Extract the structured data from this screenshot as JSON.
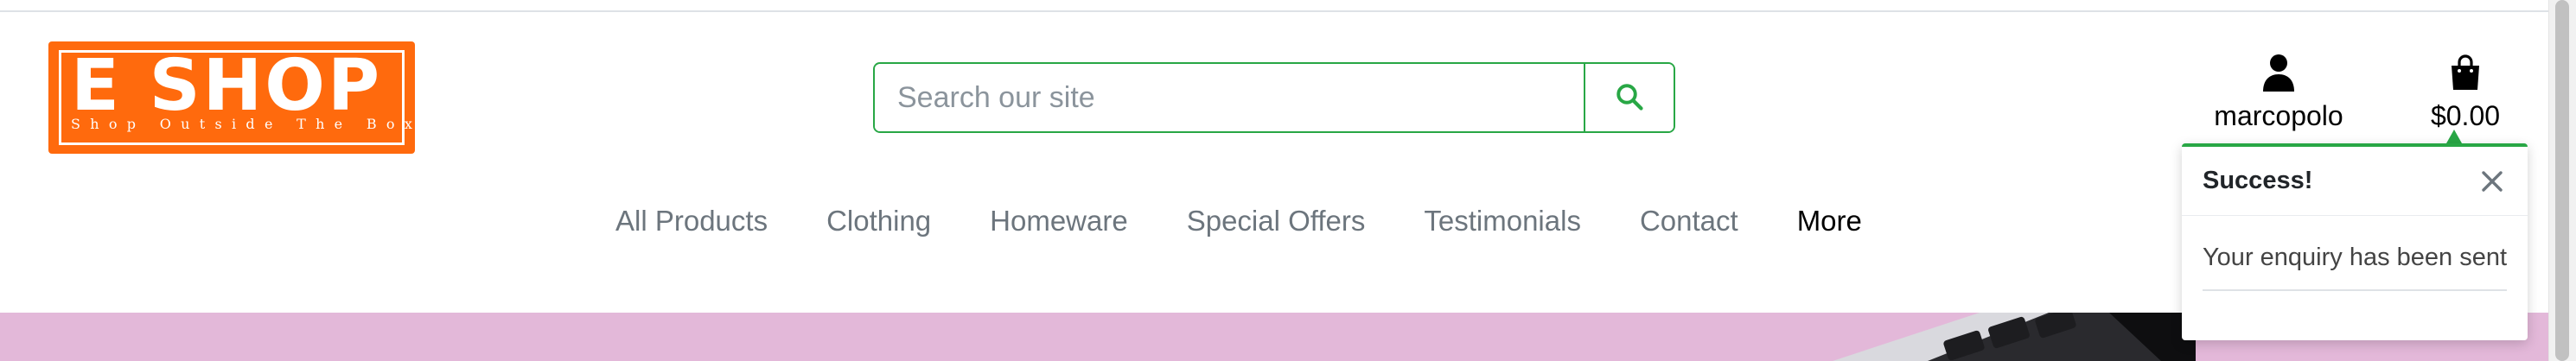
{
  "logo": {
    "title": "E SHOP",
    "tagline": "Shop Outside The Box",
    "color": "#ff6a0d"
  },
  "search": {
    "placeholder": "Search our site",
    "icon": "search-icon",
    "accent_color": "#28a745"
  },
  "account": {
    "icon": "user-icon",
    "username": "marcopolo"
  },
  "bag": {
    "icon": "shopping-bag-icon",
    "total": "$0.00"
  },
  "nav": {
    "items": [
      {
        "label": "All Products"
      },
      {
        "label": "Clothing"
      },
      {
        "label": "Homeware"
      },
      {
        "label": "Special Offers"
      },
      {
        "label": "Testimonials"
      },
      {
        "label": "Contact"
      },
      {
        "label": "More"
      }
    ]
  },
  "toast": {
    "title": "Success!",
    "message": "Your enquiry has been sent",
    "close_icon": "close-icon",
    "accent_color": "#28a745"
  },
  "hero": {
    "background_color": "#e3b8d9"
  }
}
